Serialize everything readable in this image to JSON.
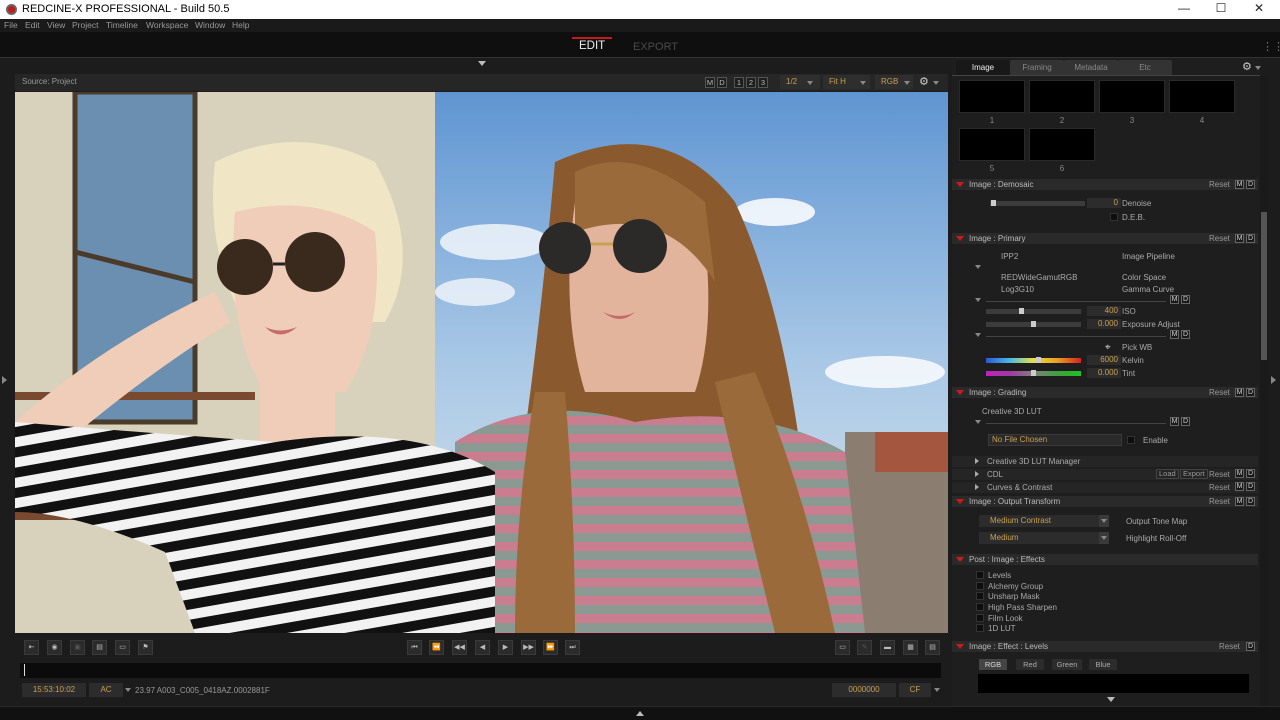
{
  "window": {
    "title": "REDCINE-X PROFESSIONAL - Build 50.5",
    "controls": [
      "—",
      "☐",
      "✕"
    ]
  },
  "menu": [
    "File",
    "Edit",
    "View",
    "Project",
    "Timeline",
    "Workspace",
    "Window",
    "Help"
  ],
  "modes": {
    "edit": "EDIT",
    "export": "EXPORT"
  },
  "viewer": {
    "source": "Source: Project",
    "m": "M",
    "d": "D",
    "n1": "1",
    "n2": "2",
    "n3": "3",
    "resolution": "1/2",
    "fit": "Fit H",
    "channel": "RGB"
  },
  "timecode": "15:53:10:02",
  "ac": "AC",
  "clip_name": "23.97 A003_C005_0418AZ.0002881F",
  "frame": "0000000",
  "cf": "CF",
  "panel": {
    "tabs": [
      "Image",
      "Framing",
      "Metadata",
      "Etc"
    ],
    "thumbs": [
      "1",
      "2",
      "3",
      "4",
      "5",
      "6"
    ],
    "reset": "Reset",
    "M": "M",
    "D": "D",
    "demosaic": {
      "title": "Image : Demosaic",
      "denoise_value": "0",
      "denoise_label": "Denoise",
      "deb_label": "D.E.B."
    },
    "primary": {
      "title": "Image : Primary",
      "ipp2": "IPP2",
      "pipeline_label": "Image Pipeline",
      "colorspace": "REDWideGamutRGB",
      "colorspace_label": "Color Space",
      "gamma": "Log3G10",
      "gamma_label": "Gamma Curve",
      "iso_value": "400",
      "iso_label": "ISO",
      "exposure_value": "0.000",
      "exposure_label": "Exposure Adjust",
      "pickwb_label": "Pick WB",
      "kelvin_value": "6000",
      "kelvin_label": "Kelvin",
      "tint_value": "0.000",
      "tint_label": "Tint",
      "iso_level": 0.37,
      "exposure_level": 0.5,
      "kelvin_level": 0.55,
      "tint_level": 0.5
    },
    "grading": {
      "title": "Image : Grading",
      "lut_label": "Creative 3D LUT",
      "no_file": "No File Chosen",
      "enable_label": "Enable",
      "lut_manager": "Creative 3D LUT Manager",
      "cdl": "CDL",
      "load": "Load",
      "export": "Export",
      "curves": "Curves & Contrast"
    },
    "output": {
      "title": "Image : Output Transform",
      "tone_value": "Medium Contrast",
      "tone_label": "Output Tone Map",
      "rolloff_value": "Medium",
      "rolloff_label": "Highlight Roll-Off"
    },
    "effects": {
      "title": "Post : Image : Effects",
      "items": [
        "Levels",
        "Alchemy Group",
        "Unsharp Mask",
        "High Pass Sharpen",
        "Film Look",
        "1D LUT"
      ]
    },
    "levels": {
      "title": "Image : Effect : Levels",
      "tabs": [
        "RGB",
        "Red",
        "Green",
        "Blue"
      ]
    }
  },
  "colors": {
    "accent_red": "#c21b1b",
    "value_gold": "#c9a050",
    "panel_bg": "#1e1e1e"
  }
}
